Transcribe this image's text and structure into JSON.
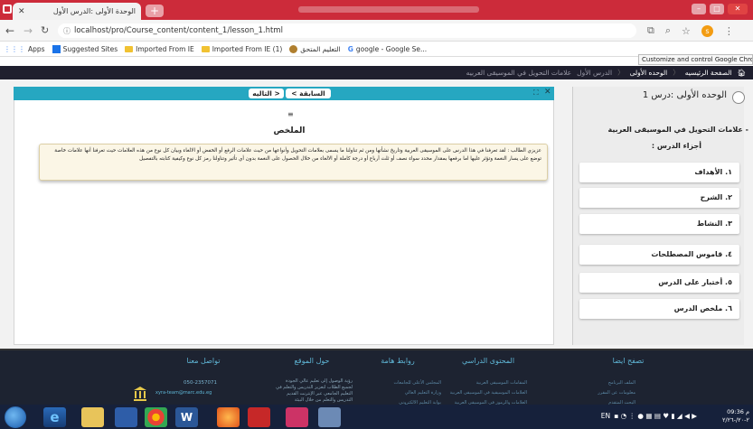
{
  "browser": {
    "tab_title": "الوحدة الأولى :الدرس الأول",
    "url": "localhost/pro/Course_content/content_1/lesson_1.html",
    "avatar_letter": "s",
    "bookmarks": [
      "Apps",
      "Suggested Sites",
      "Imported From IE",
      "Imported From IE (1)",
      "التعليم المتحق",
      "google - Google Se..."
    ],
    "tooltip": "Customize and control Google Chrome"
  },
  "site_nav": {
    "home": "الصفحة الرئيسيه",
    "unit": "الوحده الأولى",
    "lesson": "الدرس الأول",
    "topic": "علامات التحويل في الموسيقى العربيه"
  },
  "lesson": {
    "prev_label": "< السابقة",
    "next_label": "التاليه >",
    "menu_glyph": "≡",
    "summary_title": "الملخص",
    "summary_text": "عزيزي الطالب : لقد تعرفنا في هذا الدرس على الموسيقى العربية وتاريخ نشأتها ومن ثم تناولنا ما يسمى بعلامات التحويل وأنواعها من حيث علامات الرفع أو الخفض أو الالغاء وبيان كل نوع من هذه العلامات حيث تعرفنا أنها علامات خاصة توضع على يسار النغمة وتؤثر عليها اما برفعها بمقدار محدد سواء نصف أو ثلث أرباع أو درجة كاملة أو الالغاء من خلال الحصول على النغمة بدون أي تأثير وتناولنا رمز كل نوع وكيفية كتابته بالتفصيل"
  },
  "sidebar": {
    "unit_title": "الوحده الأولى :درس 1",
    "topic": "- علامات التحويل في الموسيقى العربية",
    "parts_heading": "أجزاء الدرس :",
    "parts": [
      "١. الأهداف",
      "٢. الشرح",
      "٣. النشاط",
      "٤. قاموس المصطلحات",
      "٥. أختبار على الدرس",
      "٦. ملخص الدرس"
    ]
  },
  "footer": {
    "headings": [
      "تصفح ايضا",
      "المحتوى الدراسي",
      "روابط هامة",
      "حول الموقع",
      "تواصل معنا"
    ],
    "browse_links": [
      "الملف البرنامج",
      "معلومات عن المقرر",
      "البحث المتقدم"
    ],
    "content_links": [
      "المقامات الموسيقى العربية",
      "العلامات الموسيقية في الموسيقى العربية",
      "العلامات والرموز في الموسيقى العربية"
    ],
    "important_links": [
      "المجلس الأعلى للجامعات",
      "وزارة التعليم العالي",
      "بوابة التعليم الالكتروني"
    ],
    "about_text": [
      "رؤية الوصول إلى تعليم عالي الجودة",
      "لجميع الطلاب لتعزيز التدريس والتعلم في",
      "التعليم الجامعي عبر الإنترنت القديم",
      "التدريس والتعلم من خلال البيئة"
    ],
    "phone": "050-2357071",
    "email": "xyra-team@marc.edu.eg"
  },
  "taskbar": {
    "tray": "EN",
    "time": "09:36 م",
    "date": "٢-٢٠/-٢/٢٦"
  },
  "colors": {
    "tabstrip": "#cc2b3a",
    "toolbar": "#26a7c1",
    "sitenav": "#1f1f2e",
    "footer": "#1d2331",
    "footer_heading": "#5fb6d6"
  }
}
